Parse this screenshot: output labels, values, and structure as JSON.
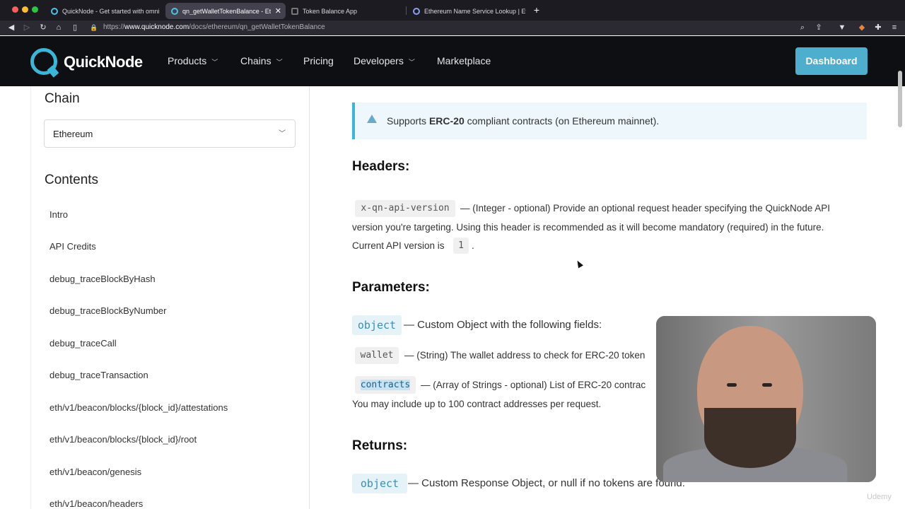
{
  "browser": {
    "tabs": [
      {
        "title": "QuickNode - Get started with omni"
      },
      {
        "title": "qn_getWalletTokenBalance - Et",
        "close": "✕"
      },
      {
        "title": "Token Balance App"
      },
      {
        "title": "Ethereum Name Service Lookup | Et"
      }
    ],
    "new_tab": "+",
    "url_prefix": "https://",
    "url_domain": "www.quicknode.com",
    "url_path": "/docs/ethereum/qn_getWalletTokenBalance",
    "colors": {
      "close": "#ff5f57",
      "minimize": "#febc2e",
      "maximize": "#28c840"
    }
  },
  "header": {
    "logo_text": "QuickNode",
    "nav": [
      {
        "label": "Products",
        "has_dropdown": true
      },
      {
        "label": "Chains",
        "has_dropdown": true
      },
      {
        "label": "Pricing",
        "has_dropdown": false
      },
      {
        "label": "Developers",
        "has_dropdown": true
      },
      {
        "label": "Marketplace",
        "has_dropdown": false
      }
    ],
    "dashboard": "Dashboard",
    "accent": "#4eaecd"
  },
  "sidebar": {
    "chain_heading": "Chain",
    "chain_value": "Ethereum",
    "contents_heading": "Contents",
    "items": [
      "Intro",
      "API Credits",
      "debug_traceBlockByHash",
      "debug_traceBlockByNumber",
      "debug_traceCall",
      "debug_traceTransaction",
      "eth/v1/beacon/blocks/{block_id}/attestations",
      "eth/v1/beacon/blocks/{block_id}/root",
      "eth/v1/beacon/genesis",
      "eth/v1/beacon/headers"
    ]
  },
  "main": {
    "note": {
      "pre": "Supports ",
      "bold": "ERC-20",
      "post": " compliant contracts (on Ethereum mainnet)."
    },
    "headers_title": "Headers:",
    "header_code": "x-qn-api-version",
    "header_desc_1": "— (Integer - optional) Provide an optional request header specifying the QuickNode API",
    "header_desc_2": "version you're targeting. Using this header is recommended as it will become mandatory (required) in the future.",
    "header_desc_3": "Current API version is",
    "api_version": "1",
    "period": ".",
    "params_title": "Parameters:",
    "param_object": "object",
    "param_object_desc": "— Custom Object with the following fields:",
    "wallet_code": "wallet",
    "wallet_desc": "— (String) The wallet address to check for ERC-20 token",
    "contracts_code": "contracts",
    "contracts_desc": "— (Array of Strings - optional) List of ERC-20 contrac",
    "contracts_desc_2": "You may include up to 100 contract addresses per request.",
    "returns_title": "Returns:",
    "return_object": "object",
    "return_desc": "— Custom Response Object, or null if no tokens are found:"
  },
  "watermark": "Udemy"
}
